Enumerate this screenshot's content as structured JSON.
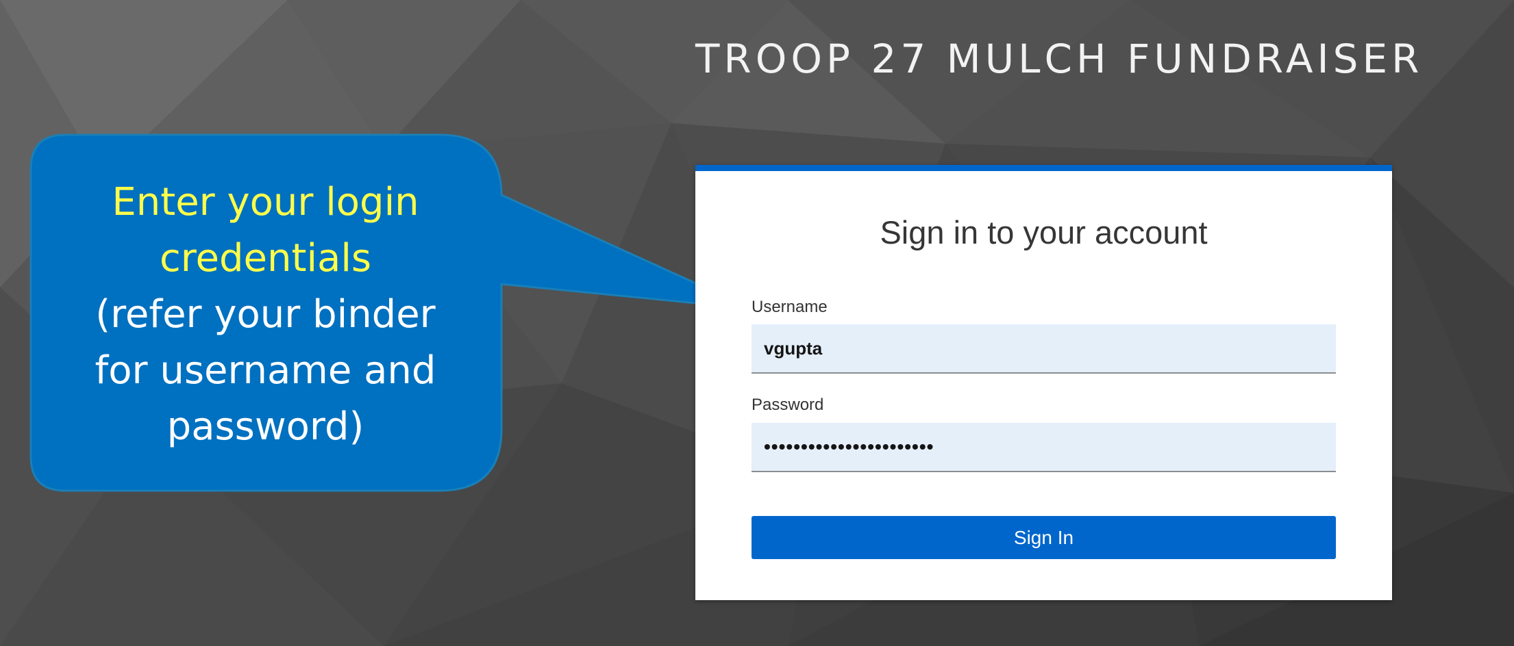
{
  "header": {
    "title": "TROOP 27 MULCH FUNDRAISER"
  },
  "callout": {
    "highlight_lines": [
      "Enter your login",
      "credentials"
    ],
    "body_lines": [
      "(refer your binder",
      "for username and",
      "password)"
    ],
    "highlight_color": "#ffff4a",
    "fill_color": "#0070c0"
  },
  "login": {
    "heading": "Sign in to your account",
    "username": {
      "label": "Username",
      "value": "vgupta"
    },
    "password": {
      "label": "Password",
      "value": "•••••••••••••••••••••••"
    },
    "submit_label": "Sign In",
    "accent_color": "#0066cc"
  }
}
